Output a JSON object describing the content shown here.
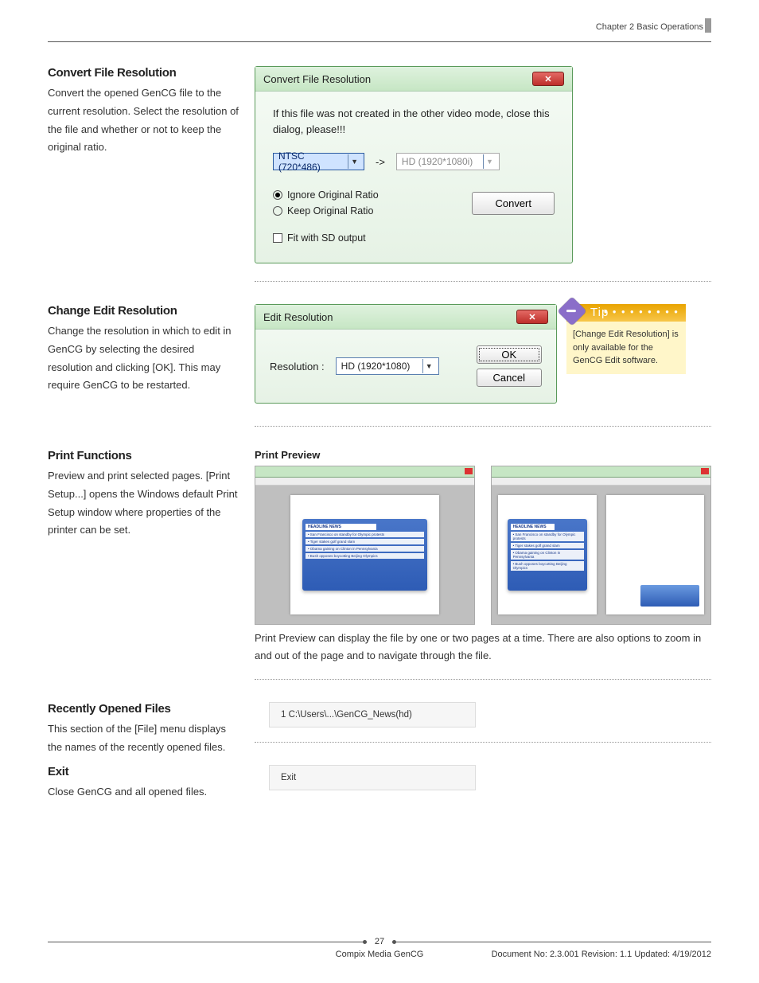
{
  "header": {
    "chapter": "Chapter 2 Basic Operations"
  },
  "sections": {
    "convert": {
      "heading": "Convert File Resolution",
      "body": "Convert the opened GenCG file to the current resolution. Select the resolution of the file and whether or not to keep the original ratio."
    },
    "change": {
      "heading": "Change Edit Resolution",
      "body": "Change the resolution in which to edit in GenCG by selecting the desired resolution and clicking [OK]. This may require GenCG to be restarted."
    },
    "print": {
      "heading": "Print Functions",
      "body": "Preview and print selected pages. [Print Setup...] opens the Windows default Print Setup window where properties of the printer can be set.",
      "sub": "Print Preview",
      "caption": "Print Preview can display the file by one or two pages at a time. There are also options to zoom in and out of the page and to navigate through the file."
    },
    "recent": {
      "heading": "Recently Opened Files",
      "body": "This section of the [File] menu displays the names of the recently opened files."
    },
    "exit": {
      "heading": "Exit",
      "body": "Close GenCG and all opened files."
    }
  },
  "dialog_convert": {
    "title": "Convert File Resolution",
    "message": "If this file was not created in the other video mode, close this dialog, please!!!",
    "from": "NTSC (720*486)",
    "arrow": "->",
    "to": "HD (1920*1080i)",
    "radio1": "Ignore Original Ratio",
    "radio2": "Keep Original Ratio",
    "check": "Fit with SD output",
    "button": "Convert"
  },
  "dialog_edit": {
    "title": "Edit Resolution",
    "label": "Resolution :",
    "value": "HD (1920*1080)",
    "ok": "OK",
    "cancel": "Cancel"
  },
  "tip": {
    "title": "Tip",
    "body": "[Change Edit Resolution] is only available for the GenCG Edit software."
  },
  "preview_card": {
    "headline": "HEADLINE NEWS",
    "l1": "• San Francisco on standby for Olympic protests",
    "l2": "• Tiger stakes golf grand slam",
    "l3": "• Obama gaining on Clinton in Pennsylvania",
    "l4": "• Bush opposes boycotting Beijing Olympics"
  },
  "recent_menu": {
    "item": "1 C:\\Users\\...\\GenCG_News(hd)"
  },
  "exit_menu": {
    "item": "Exit"
  },
  "footer": {
    "page": "27",
    "product": "Compix Media GenCG",
    "docinfo": "Document No: 2.3.001 Revision: 1.1 Updated: 4/19/2012"
  }
}
